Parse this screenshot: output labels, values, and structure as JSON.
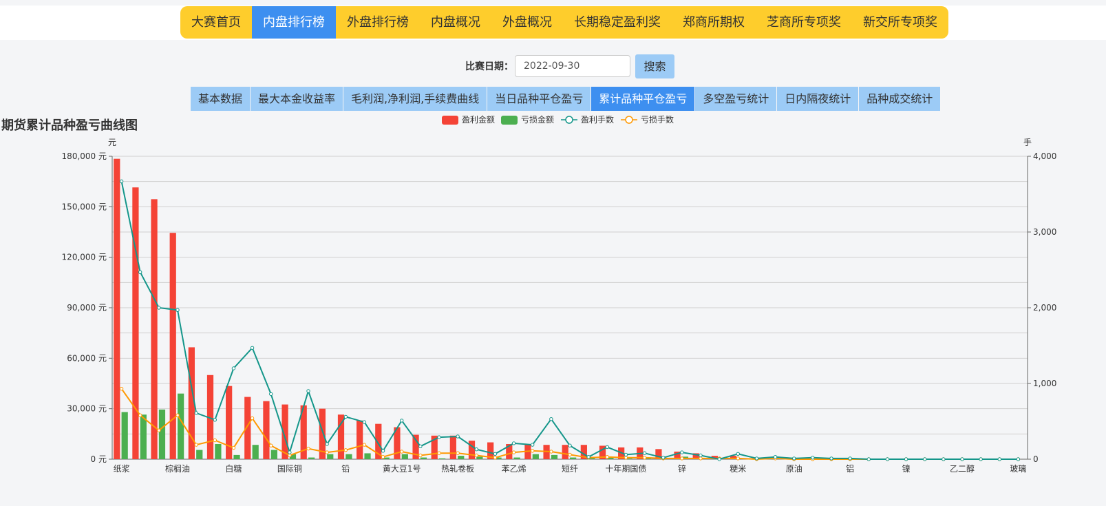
{
  "main_nav": [
    {
      "label": "大赛首页",
      "active": false
    },
    {
      "label": "内盘排行榜",
      "active": true
    },
    {
      "label": "外盘排行榜",
      "active": false
    },
    {
      "label": "内盘概况",
      "active": false
    },
    {
      "label": "外盘概况",
      "active": false
    },
    {
      "label": "长期稳定盈利奖",
      "active": false
    },
    {
      "label": "郑商所期权",
      "active": false
    },
    {
      "label": "芝商所专项奖",
      "active": false
    },
    {
      "label": "新交所专项奖",
      "active": false
    }
  ],
  "date_filter": {
    "label": "比赛日期：",
    "value": "2022-09-30",
    "search_label": "搜索"
  },
  "sub_tabs": [
    {
      "label": "基本数据",
      "active": false
    },
    {
      "label": "最大本金收益率",
      "active": false
    },
    {
      "label": "毛利润,净利润,手续费曲线",
      "active": false
    },
    {
      "label": "当日品种平仓盈亏",
      "active": false
    },
    {
      "label": "累计品种平仓盈亏",
      "active": true
    },
    {
      "label": "多空盈亏统计",
      "active": false
    },
    {
      "label": "日内隔夜统计",
      "active": false
    },
    {
      "label": "品种成交统计",
      "active": false
    }
  ],
  "colors": {
    "profit_amount": "#f44336",
    "loss_amount": "#4caf50",
    "profit_lots": "#14968a",
    "loss_lots": "#ff9800",
    "nav_bg": "#fecd2c",
    "nav_active": "#3d8ff0",
    "tab_bg": "#9ccbf6"
  },
  "chart_data": {
    "type": "bar",
    "title": "期货累计品种盈亏曲线图",
    "y_unit": "元",
    "y2_unit": "手",
    "ylim": [
      0,
      180000
    ],
    "y2lim": [
      0,
      4000
    ],
    "yticks": [
      0,
      30000,
      60000,
      90000,
      120000,
      150000,
      180000
    ],
    "yticklabels": [
      "0 元",
      "30,000 元",
      "60,000 元",
      "90,000 元",
      "120,000 元",
      "150,000 元",
      "180,000 元"
    ],
    "y2ticks": [
      0,
      1000,
      2000,
      3000,
      4000
    ],
    "y2ticklabels": [
      "0",
      "1,000",
      "2,000",
      "3,000",
      "4,000"
    ],
    "legend_position": "top-center",
    "grid": true,
    "category_count": 49,
    "categories": [
      "纸浆",
      "",
      "",
      "棕榈油",
      "",
      "",
      "白糖",
      "",
      "",
      "国际铜",
      "",
      "",
      "铅",
      "",
      "",
      "黄大豆1号",
      "",
      "",
      "热轧卷板",
      "",
      "",
      "苯乙烯",
      "",
      "",
      "短纤",
      "",
      "",
      "十年期国债",
      "",
      "",
      "锌",
      "",
      "",
      "粳米",
      "",
      "",
      "原油",
      "",
      "",
      "铝",
      "",
      "",
      "镍",
      "",
      "",
      "乙二醇",
      "",
      "",
      "玻璃"
    ],
    "series": [
      {
        "name": "盈利金额",
        "type": "bar",
        "axis": "left",
        "values": [
          178500,
          161500,
          154500,
          134500,
          66500,
          50000,
          43500,
          37000,
          34500,
          32500,
          32000,
          30000,
          26500,
          23000,
          21000,
          19000,
          14500,
          14000,
          14000,
          11000,
          10000,
          9000,
          9000,
          8500,
          8500,
          8500,
          8000,
          7000,
          7000,
          6000,
          4500,
          3500,
          2000,
          2000,
          500,
          0,
          0,
          0,
          0,
          0,
          0,
          0,
          0,
          0,
          0,
          0,
          0,
          0,
          0
        ]
      },
      {
        "name": "亏损金额",
        "type": "bar",
        "axis": "left",
        "values": [
          28000,
          26500,
          29500,
          39000,
          5500,
          9000,
          2500,
          8500,
          5500,
          3000,
          1000,
          3000,
          3000,
          3500,
          1000,
          3000,
          1000,
          500,
          2000,
          1500,
          1000,
          1000,
          3000,
          2500,
          1000,
          1000,
          1000,
          500,
          500,
          500,
          1500,
          500,
          500,
          0,
          0,
          0,
          0,
          0,
          0,
          0,
          0,
          0,
          0,
          0,
          0,
          0,
          0,
          0,
          0
        ]
      },
      {
        "name": "盈利手数",
        "type": "line",
        "axis": "right",
        "values": [
          3670,
          2470,
          2000,
          1970,
          610,
          520,
          1200,
          1470,
          860,
          90,
          900,
          200,
          560,
          490,
          110,
          510,
          170,
          290,
          300,
          130,
          70,
          210,
          190,
          530,
          180,
          30,
          160,
          60,
          80,
          20,
          90,
          50,
          0,
          70,
          10,
          30,
          10,
          20,
          10,
          10,
          0,
          0,
          0,
          0,
          0,
          0,
          0,
          0,
          0
        ]
      },
      {
        "name": "亏损手数",
        "type": "line",
        "axis": "right",
        "values": [
          930,
          580,
          380,
          580,
          190,
          250,
          150,
          540,
          180,
          50,
          140,
          90,
          120,
          190,
          30,
          100,
          50,
          80,
          80,
          50,
          20,
          90,
          110,
          100,
          60,
          20,
          30,
          20,
          20,
          10,
          10,
          10,
          10,
          10,
          0,
          10,
          0,
          0,
          0,
          0,
          0,
          0,
          0,
          0,
          0,
          0,
          0,
          0,
          0
        ]
      }
    ]
  },
  "footer_partial": "..."
}
